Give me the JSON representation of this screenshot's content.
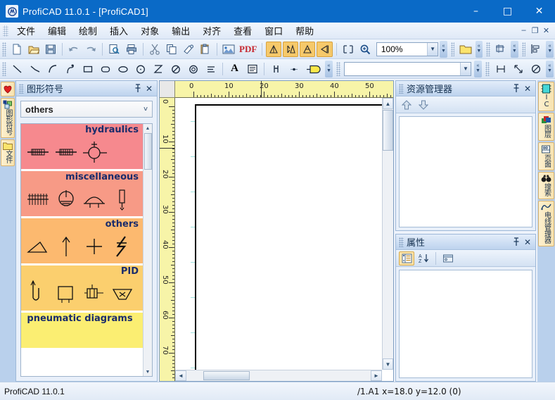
{
  "window": {
    "title": "ProfiCAD 11.0.1 - [ProfiCAD1]",
    "app_icon": "proficad-icon",
    "minimize": "–",
    "maximize": "□",
    "close": "✕",
    "inner_minimize": "–",
    "inner_restore": "❐",
    "inner_close": "✕"
  },
  "menubar": {
    "items": [
      {
        "label": "文件",
        "name": "menu-file"
      },
      {
        "label": "编辑",
        "name": "menu-edit"
      },
      {
        "label": "绘制",
        "name": "menu-draw"
      },
      {
        "label": "插入",
        "name": "menu-insert"
      },
      {
        "label": "对象",
        "name": "menu-object"
      },
      {
        "label": "输出",
        "name": "menu-output"
      },
      {
        "label": "对齐",
        "name": "menu-align"
      },
      {
        "label": "查看",
        "name": "menu-view"
      },
      {
        "label": "窗口",
        "name": "menu-window"
      },
      {
        "label": "帮助",
        "name": "menu-help"
      }
    ]
  },
  "toolbar_main": {
    "buttons": [
      "new-document-icon",
      "open-folder-icon",
      "save-icon",
      "undo-icon",
      "redo-icon",
      "print-preview-icon",
      "print-icon",
      "cut-icon",
      "copy-icon",
      "format-painter-icon",
      "paste-icon",
      "insert-image-icon",
      "export-pdf-icon",
      "rotate-left-icon",
      "flip-vertical-icon",
      "rotate-right-icon",
      "mirror-icon",
      "fit-page-icon",
      "zoom-in-icon"
    ],
    "pdf_label": "PDF",
    "zoom": {
      "value": "100%",
      "arrow": "▼"
    },
    "extra_buttons": [
      "open-library-icon",
      "crop-icon",
      "align-icon"
    ],
    "overflow": "»"
  },
  "toolbar_draw": {
    "buttons": [
      "line-icon",
      "polyline-icon",
      "arc-icon",
      "bezier-icon",
      "rectangle-icon",
      "rounded-rectangle-icon",
      "ellipse-icon",
      "circle-icon",
      "hourglass-icon",
      "slashed-circle-icon",
      "double-circle-icon",
      "lines-icon",
      "text-icon",
      "text-block-icon",
      "terminal-icon",
      "point-icon",
      "note-icon"
    ],
    "font_combo": {
      "value": "",
      "arrow": "▼"
    },
    "measure_buttons": [
      "dimension-icon",
      "measure-arrow-icon",
      "diameter-icon"
    ],
    "overflow": "»"
  },
  "left_dock": {
    "tabs": [
      {
        "name": "favorites-tab",
        "icon": "heart-icon",
        "label": ""
      },
      {
        "name": "symbols-tab",
        "icon": "symbols-icon",
        "label": "图形符号"
      },
      {
        "name": "files-tab",
        "icon": "folder-icon",
        "label": "文件"
      }
    ]
  },
  "symbols_panel": {
    "title": "图形符号",
    "pin": "⚓",
    "close": "✕",
    "selected_library": "others",
    "chevron": "˅",
    "scroll_up": "▲",
    "scroll_down": "▼",
    "groups": [
      {
        "title": "hydraulics",
        "color": "#f6898e",
        "items": [
          "hyd-sym-1",
          "hyd-sym-2",
          "hyd-sym-3"
        ]
      },
      {
        "title": "miscellaneous",
        "color": "#f79a86",
        "items": [
          "misc-sym-1",
          "misc-sym-2",
          "misc-sym-3",
          "misc-sym-4"
        ]
      },
      {
        "title": "others",
        "color": "#fcb униформ",
        "items": [
          "other-sym-1",
          "other-sym-2",
          "other-sym-3",
          "other-sym-4"
        ]
      },
      {
        "title": "PID",
        "color": "#fbcf6e",
        "items": [
          "pid-sym-1",
          "pid-sym-2",
          "pid-sym-3",
          "pid-sym-4"
        ]
      },
      {
        "title": "pneumatic diagrams",
        "color": "#fbee72",
        "items": []
      }
    ]
  },
  "canvas": {
    "h_ruler_labels": [
      "0",
      "10",
      "20",
      "30",
      "40",
      "50"
    ],
    "v_ruler_labels": [
      "0",
      "10",
      "20",
      "30",
      "40",
      "50",
      "60",
      "70"
    ],
    "grid_color": "#9fe3df",
    "page_border_color": "#000000",
    "scroll_up": "▲",
    "scroll_down": "▼",
    "scroll_left": "◄",
    "scroll_right": "►"
  },
  "resource_panel": {
    "title": "资源管理器",
    "pin": "⚓",
    "close": "✕",
    "buttons": [
      "move-up-icon",
      "move-down-icon"
    ]
  },
  "properties_panel": {
    "title": "属性",
    "pin": "⚓",
    "close": "✕",
    "buttons": [
      "categorized-icon",
      "sort-alpha-icon",
      "property-pages-icon"
    ]
  },
  "right_dock": {
    "tabs": [
      {
        "name": "ic-tab",
        "icon": "ic-chip-icon",
        "label": "IC"
      },
      {
        "name": "layers-tab",
        "icon": "layers-icon",
        "label": "图层"
      },
      {
        "name": "pages-tab",
        "icon": "pages-icon",
        "label": "页面"
      },
      {
        "name": "search-tab",
        "icon": "binoculars-icon",
        "label": "搜索"
      },
      {
        "name": "wire-manager-tab",
        "icon": "wire-icon",
        "label": "电线管理器"
      }
    ]
  },
  "statusbar": {
    "app_version": "ProfiCAD 11.0.1",
    "coordinates": "/1.A1  x=18.0  y=12.0 (0)"
  }
}
